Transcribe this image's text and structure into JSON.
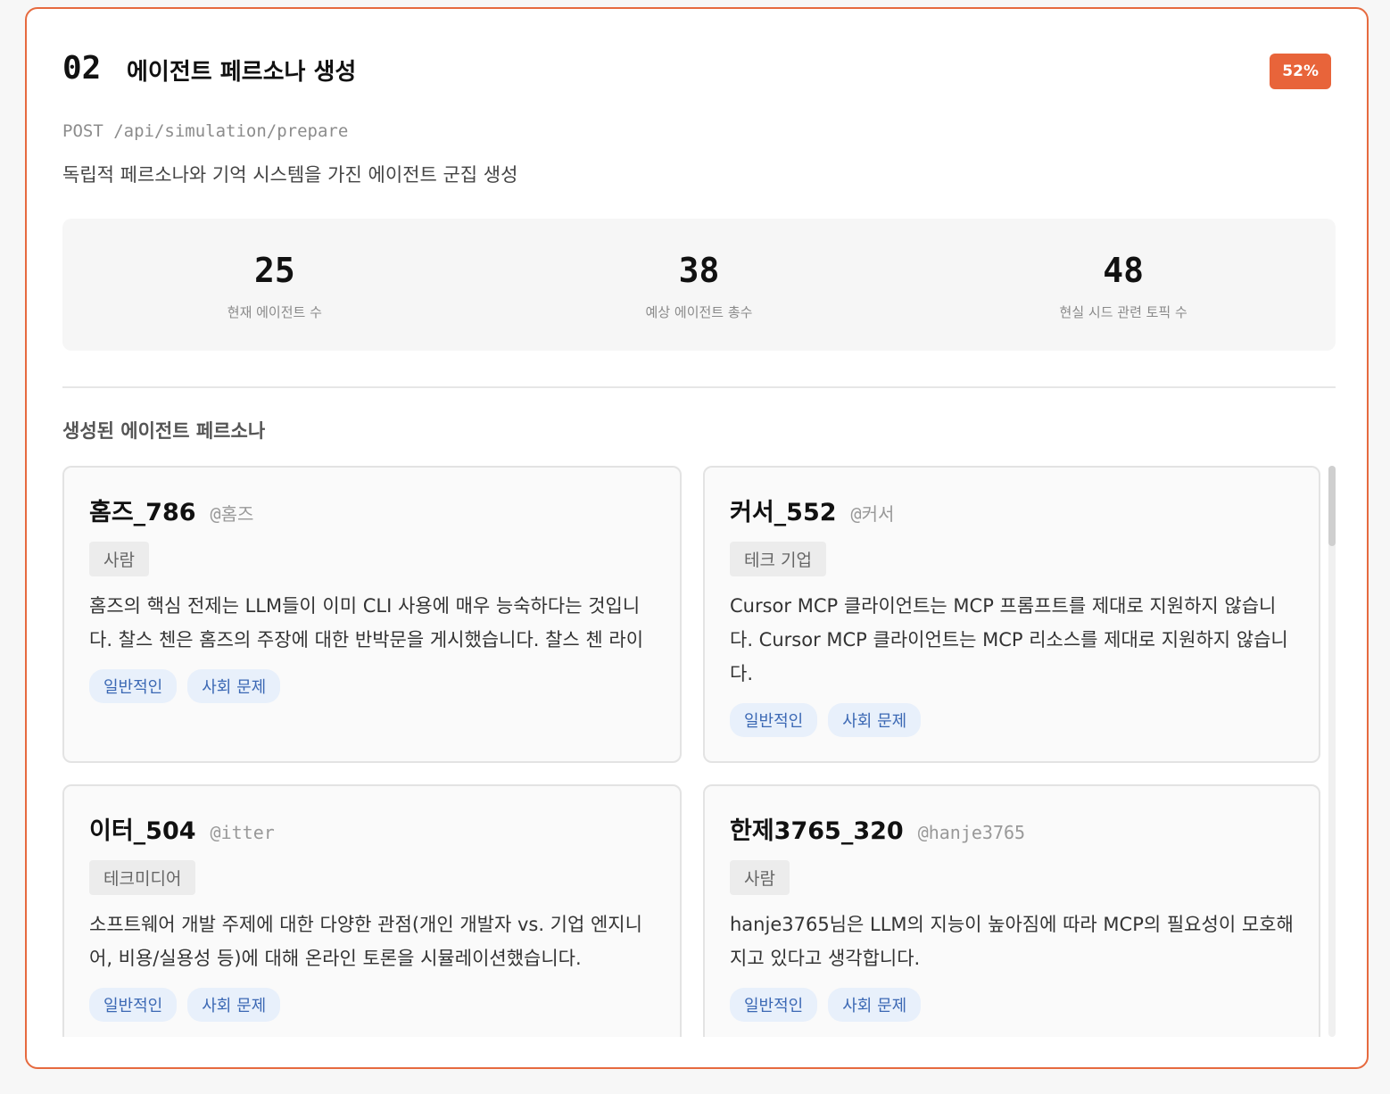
{
  "step": {
    "number": "02",
    "title": "에이전트 페르소나 생성",
    "progress": "52%",
    "endpoint": "POST /api/simulation/prepare",
    "description": "독립적 페르소나와 기억 시스템을 가진 에이전트 군집 생성"
  },
  "stats": [
    {
      "value": "25",
      "label": "현재 에이전트 수"
    },
    {
      "value": "38",
      "label": "예상 에이전트 총수"
    },
    {
      "value": "48",
      "label": "현실 시드 관련 토픽 수"
    }
  ],
  "section_title": "생성된 에이전트 페르소나",
  "personas": [
    {
      "name": "홈즈_786",
      "handle": "@홈즈",
      "type": "사람",
      "bio": "홈즈의 핵심 전제는 LLM들이 이미 CLI 사용에 매우 능숙하다는 것입니다. 찰스 첸은 홈즈의 주장에 대한 반박문을 게시했습니다. 찰스 첸 라이",
      "tags": [
        "일반적인",
        "사회 문제"
      ]
    },
    {
      "name": "커서_552",
      "handle": "@커서",
      "type": "테크 기업",
      "bio": "Cursor MCP 클라이언트는 MCP 프롬프트를 제대로 지원하지 않습니다. Cursor MCP 클라이언트는 MCP 리소스를 제대로 지원하지 않습니다.",
      "tags": [
        "일반적인",
        "사회 문제"
      ]
    },
    {
      "name": "이터_504",
      "handle": "@itter",
      "type": "테크미디어",
      "bio": "소프트웨어 개발 주제에 대한 다양한 관점(개인 개발자 vs. 기업 엔지니어, 비용/실용성 등)에 대해 온라인 토론을 시뮬레이션했습니다.",
      "tags": [
        "일반적인",
        "사회 문제"
      ]
    },
    {
      "name": "한제3765_320",
      "handle": "@hanje3765",
      "type": "사람",
      "bio": "hanje3765님은 LLM의 지능이 높아짐에 따라 MCP의 필요성이 모호해지고 있다고 생각합니다.",
      "tags": [
        "일반적인",
        "사회 문제"
      ]
    }
  ]
}
